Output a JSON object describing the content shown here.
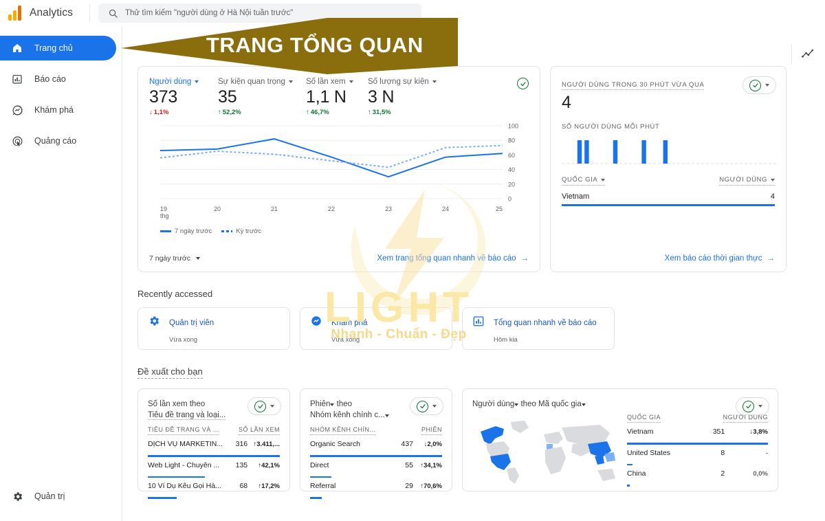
{
  "app": {
    "brand": "Analytics",
    "logo_icon": "google-analytics-logo",
    "search": {
      "icon": "search-icon",
      "placeholder": "Thử tìm kiếm \"người dùng ở Hà Nội tuần trước\""
    },
    "insights_icon": "sparkline-insights-icon"
  },
  "sidebar": {
    "items": [
      {
        "label": "Trang chủ",
        "icon": "home-icon",
        "active": true
      },
      {
        "label": "Báo cáo",
        "icon": "bar-chart-icon",
        "active": false
      },
      {
        "label": "Khám phá",
        "icon": "explore-icon",
        "active": false
      },
      {
        "label": "Quảng cáo",
        "icon": "ads-target-icon",
        "active": false
      }
    ],
    "bottom": {
      "label": "Quản trị",
      "icon": "gear-icon"
    }
  },
  "overlay": {
    "arrow_label": "TRANG TỔNG QUAN",
    "arrow_color": "#8a6d0d"
  },
  "watermark": {
    "title": "LIGHT",
    "tagline": "Nhanh - Chuẩn - Đẹp",
    "logo_icon": "lightning-bolt-logo"
  },
  "overview_card": {
    "metrics": [
      {
        "label": "Người dùng",
        "value": "373",
        "delta": "1,1%",
        "direction": "down"
      },
      {
        "label": "Sự kiện quan trọng",
        "value": "35",
        "delta": "52,2%",
        "direction": "up"
      },
      {
        "label": "Số lần xem",
        "value": "1,1 N",
        "delta": "46,7%",
        "direction": "up"
      },
      {
        "label": "Số lượng sự kiện",
        "value": "3 N",
        "delta": "31,5%",
        "direction": "up"
      }
    ],
    "status_icon": "check-circle-icon",
    "legend": [
      {
        "label": "7 ngày trước",
        "style": "solid"
      },
      {
        "label": "Kỳ trước",
        "style": "dashed"
      }
    ],
    "range_label": "7 ngày trước",
    "link_label": "Xem trang tổng quan nhanh về báo cáo",
    "link_icon": "arrow-right-icon"
  },
  "chart_data": {
    "type": "line",
    "title": "Người dùng",
    "x": [
      "19",
      "20",
      "21",
      "22",
      "23",
      "24",
      "25"
    ],
    "x_unit_label": "thg",
    "xlabel": "",
    "ylabel": "",
    "ylim": [
      0,
      100
    ],
    "yticks": [
      0,
      20,
      40,
      60,
      80,
      100
    ],
    "grid": true,
    "legend_position": "bottom-left",
    "series": [
      {
        "name": "7 ngày trước",
        "style": "solid",
        "color": "#1a73e8",
        "values": [
          66,
          68,
          82,
          57,
          30,
          57,
          62
        ]
      },
      {
        "name": "Kỳ trước",
        "style": "dashed",
        "color": "#7baaf7",
        "values": [
          56,
          65,
          61,
          52,
          43,
          70,
          73
        ]
      }
    ]
  },
  "realtime_card": {
    "title": "NGƯỜI DÙNG TRONG 30 PHÚT VỪA QUA",
    "value": "4",
    "sub_title": "SỐ NGƯỜI DÙNG MỖI PHÚT",
    "status_icon": "check-circle-icon",
    "dropdown_icon": "chevron-down-icon",
    "minute_chart": {
      "type": "bar",
      "categories": [
        "-30",
        "-29",
        "-28",
        "-27",
        "-26",
        "-25",
        "-24",
        "-23",
        "-22",
        "-21",
        "-20",
        "-19",
        "-18",
        "-17",
        "-16",
        "-15",
        "-14",
        "-13",
        "-12",
        "-11",
        "-10",
        "-9",
        "-8",
        "-7",
        "-6",
        "-5",
        "-4",
        "-3",
        "-2",
        "-1"
      ],
      "values": [
        0,
        0,
        1,
        1,
        0,
        0,
        0,
        1,
        0,
        0,
        0,
        1,
        0,
        0,
        1,
        0,
        0,
        0,
        0,
        0,
        0,
        0,
        0,
        0,
        0,
        0,
        0,
        0,
        0,
        0
      ],
      "ylim": [
        0,
        1
      ]
    },
    "table": {
      "columns": [
        "QUỐC GIA",
        "NGƯỜI DÙNG"
      ],
      "rows": [
        {
          "country": "Vietnam",
          "users": "4"
        }
      ]
    },
    "link_label": "Xem báo cáo thời gian thực",
    "link_icon": "arrow-right-icon"
  },
  "recently_accessed": {
    "title": "Recently accessed",
    "items": [
      {
        "label": "Quản trị viên",
        "sub": "Vừa xong",
        "icon": "gear-icon"
      },
      {
        "label": "Khám phá",
        "sub": "Vừa xong",
        "icon": "explore-icon"
      },
      {
        "label": "Tổng quan nhanh về báo cáo",
        "sub": "Hôm kia",
        "icon": "bar-chart-icon"
      }
    ]
  },
  "suggestions": {
    "title": "Đề xuất cho bạn",
    "card1": {
      "heading_line1": "Số lần xem theo",
      "heading_line2": "Tiêu đề trang và loại...",
      "status_icon": "check-circle-icon",
      "dropdown_icon": "chevron-down-icon",
      "columns": [
        "TIÊU ĐỀ TRANG VÀ ...",
        "SỐ LẦN XEM"
      ],
      "rows": [
        {
          "name": "DỊCH VỤ MARKETIN...",
          "value": "316",
          "delta": "3.411,...",
          "direction": "up",
          "bar": 100
        },
        {
          "name": "Web Light - Chuyên ...",
          "value": "135",
          "delta": "42,1%",
          "direction": "up",
          "bar": 43
        },
        {
          "name": "10 Ví Dụ Kêu Gọi Hà...",
          "value": "68",
          "delta": "17,2%",
          "direction": "up",
          "bar": 22
        }
      ]
    },
    "card2": {
      "heading_line1": "Phiên",
      "heading_line1_suffix": "theo",
      "heading_line2": "Nhóm kênh chính c...",
      "status_icon": "check-circle-icon",
      "dropdown_icon": "chevron-down-icon",
      "columns": [
        "NHÓM KÊNH CHÍN...",
        "PHIÊN"
      ],
      "rows": [
        {
          "name": "Organic Search",
          "value": "437",
          "delta": "2,0%",
          "direction": "down",
          "bar": 100
        },
        {
          "name": "Direct",
          "value": "55",
          "delta": "34,1%",
          "direction": "up",
          "bar": 16
        },
        {
          "name": "Referral",
          "value": "29",
          "delta": "70,6%",
          "direction": "up",
          "bar": 9
        }
      ]
    },
    "card3": {
      "heading_part1": "Người dùng",
      "heading_part2": "theo Mã quốc gia",
      "status_icon": "check-circle-icon",
      "dropdown_icon": "chevron-down-icon",
      "map_icon": "world-map",
      "columns": [
        "QUỐC GIA",
        "NGƯỜI DÙNG"
      ],
      "rows": [
        {
          "name": "Vietnam",
          "value": "351",
          "delta": "3,8%",
          "direction": "down",
          "bar": 100
        },
        {
          "name": "United States",
          "value": "8",
          "delta": "-",
          "direction": "none",
          "bar": 4
        },
        {
          "name": "China",
          "value": "2",
          "delta": "0,0%",
          "direction": "none",
          "bar": 2
        }
      ]
    }
  }
}
